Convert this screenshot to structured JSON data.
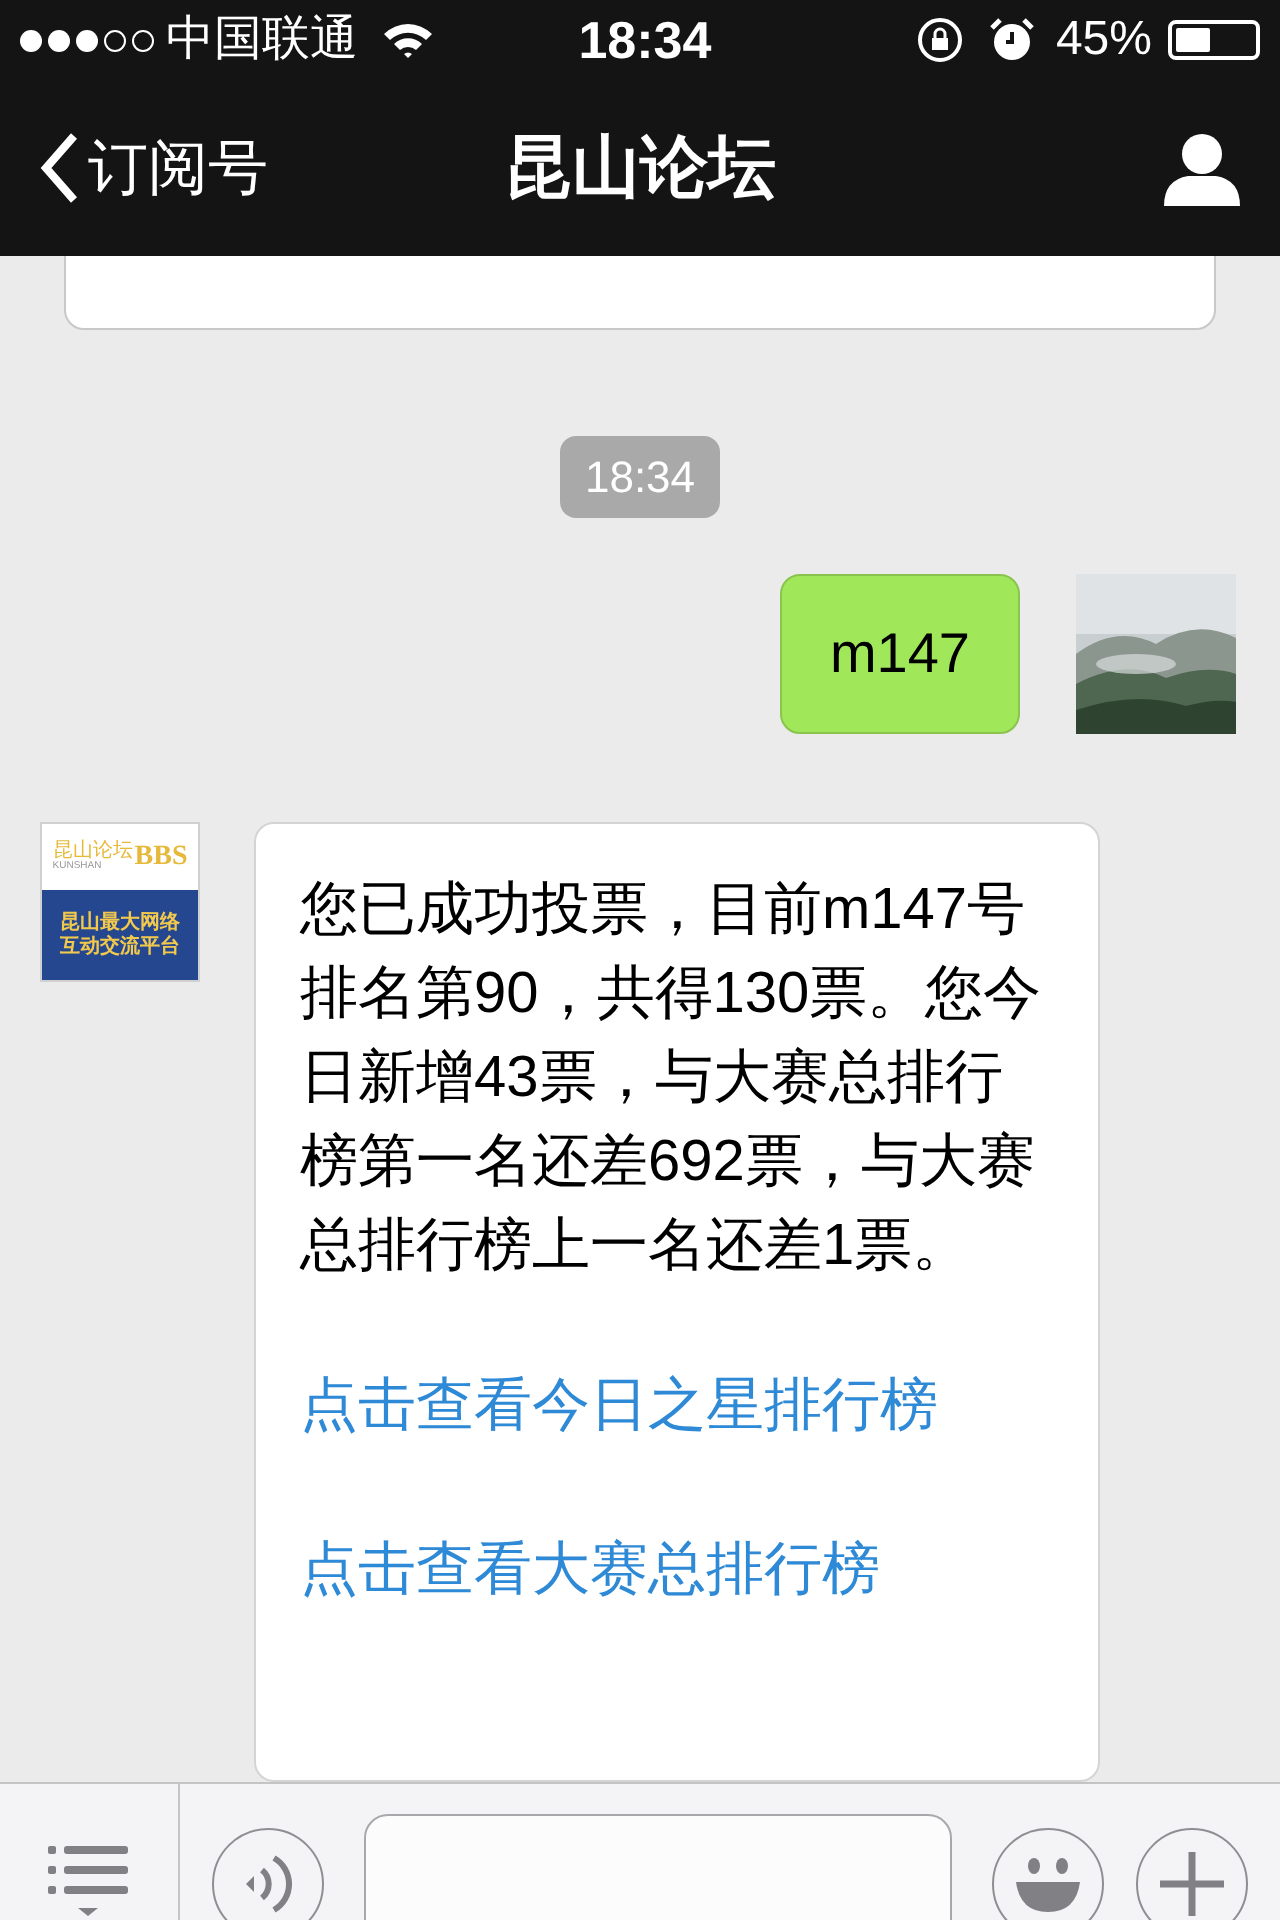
{
  "status_bar": {
    "signal_dots": [
      {
        "filled": true
      },
      {
        "filled": true
      },
      {
        "filled": true
      },
      {
        "filled": false
      },
      {
        "filled": false
      }
    ],
    "carrier": "中国联通",
    "time": "18:34",
    "battery_percent": "45%"
  },
  "nav_bar": {
    "back_label": "订阅号",
    "title": "昆山论坛"
  },
  "messages": [
    {
      "kind": "timestamp",
      "text": "18:34"
    },
    {
      "kind": "outgoing",
      "text": "m147"
    },
    {
      "kind": "incoming",
      "avatar": {
        "top_text": "昆山论坛",
        "sub_text": "KUNSHAN",
        "badge_text": "BBS",
        "lines": [
          "昆山最大网络",
          "互动交流平台"
        ]
      },
      "text": "您已成功投票，目前m147号排名第90，共得130票。您今日新增43票，与大赛总排行榜第一名还差692票，与大赛总排行榜上一名还差1票。",
      "links": [
        "点击查看今日之星排行榜",
        "点击查看大赛总排行榜"
      ]
    }
  ]
}
